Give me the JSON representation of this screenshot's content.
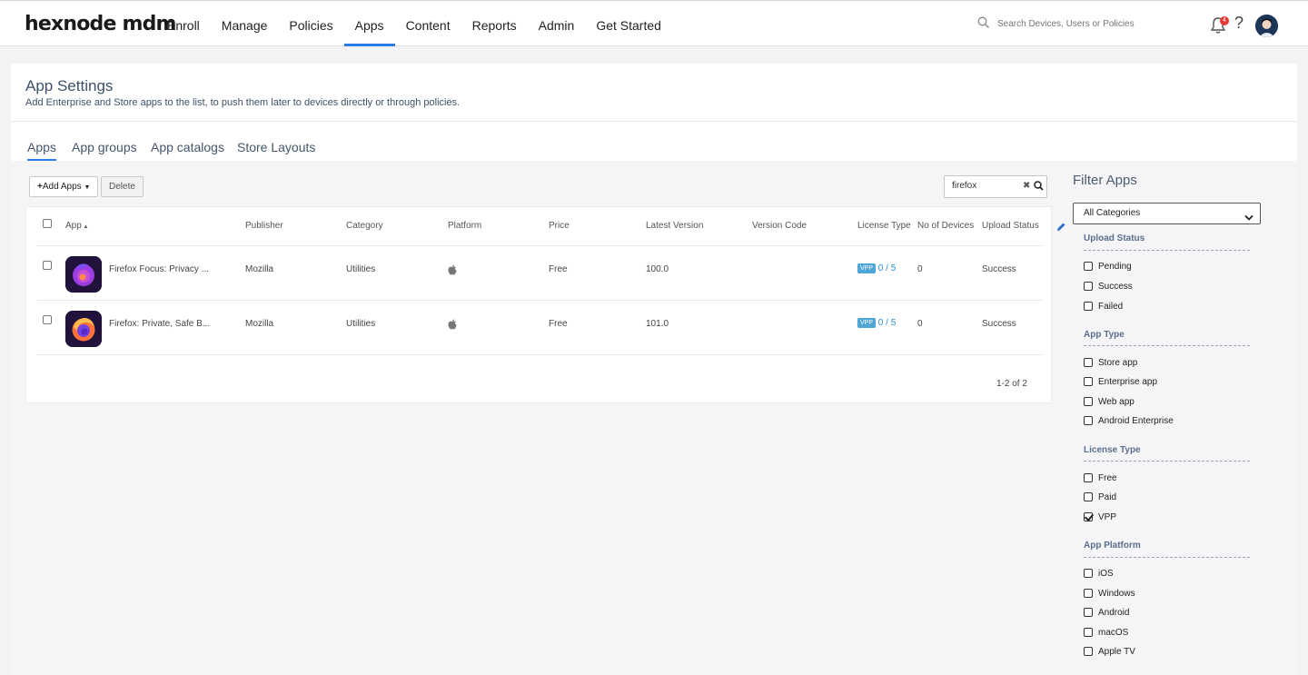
{
  "topbar": {
    "logo": "hexnode mdm",
    "nav": [
      "Enroll",
      "Manage",
      "Policies",
      "Apps",
      "Content",
      "Reports",
      "Admin",
      "Get Started"
    ],
    "active_nav": "Apps",
    "search_placeholder": "Search Devices, Users or Policies",
    "notification_count": "4"
  },
  "page": {
    "title": "App Settings",
    "subtitle": "Add Enterprise and Store apps to the list, to push them later to devices directly or through policies.",
    "tabs": [
      "Apps",
      "App groups",
      "App catalogs",
      "Store Layouts"
    ],
    "active_tab": "Apps"
  },
  "toolbar": {
    "add_apps": "Add Apps",
    "delete": "Delete",
    "search_value": "firefox"
  },
  "table": {
    "columns": [
      "App",
      "Publisher",
      "Category",
      "Platform",
      "Price",
      "Latest Version",
      "Version Code",
      "License Type",
      "No of Devices",
      "Upload Status"
    ],
    "rows": [
      {
        "name": "Firefox Focus: Privacy ...",
        "publisher": "Mozilla",
        "category": "Utilities",
        "platform": "apple-icon",
        "price": "Free",
        "latest_version": "100.0",
        "version_code": "",
        "license_badge": "VPP",
        "license_count": "0 / 5",
        "devices": "0",
        "upload_status": "Success"
      },
      {
        "name": "Firefox: Private, Safe B...",
        "publisher": "Mozilla",
        "category": "Utilities",
        "platform": "apple-icon",
        "price": "Free",
        "latest_version": "101.0",
        "version_code": "",
        "license_badge": "VPP",
        "license_count": "0 / 5",
        "devices": "0",
        "upload_status": "Success"
      }
    ],
    "pagination": "1-2 of 2"
  },
  "filter": {
    "title": "Filter Apps",
    "category_select": "All Categories",
    "sections": [
      {
        "title": "Upload Status",
        "options": [
          {
            "label": "Pending",
            "checked": false
          },
          {
            "label": "Success",
            "checked": false
          },
          {
            "label": "Failed",
            "checked": false
          }
        ]
      },
      {
        "title": "App Type",
        "options": [
          {
            "label": "Store app",
            "checked": false
          },
          {
            "label": "Enterprise app",
            "checked": false
          },
          {
            "label": "Web app",
            "checked": false
          },
          {
            "label": "Android Enterprise",
            "checked": false
          }
        ]
      },
      {
        "title": "License Type",
        "options": [
          {
            "label": "Free",
            "checked": false
          },
          {
            "label": "Paid",
            "checked": false
          },
          {
            "label": "VPP",
            "checked": true
          }
        ]
      },
      {
        "title": "App Platform",
        "options": [
          {
            "label": "iOS",
            "checked": false
          },
          {
            "label": "Windows",
            "checked": false
          },
          {
            "label": "Android",
            "checked": false
          },
          {
            "label": "macOS",
            "checked": false
          },
          {
            "label": "Apple TV",
            "checked": false
          }
        ]
      }
    ]
  },
  "colors": {
    "accent": "#2a7be4",
    "vpp_badge": "#4ea6d6",
    "title_text": "#3e5068"
  }
}
